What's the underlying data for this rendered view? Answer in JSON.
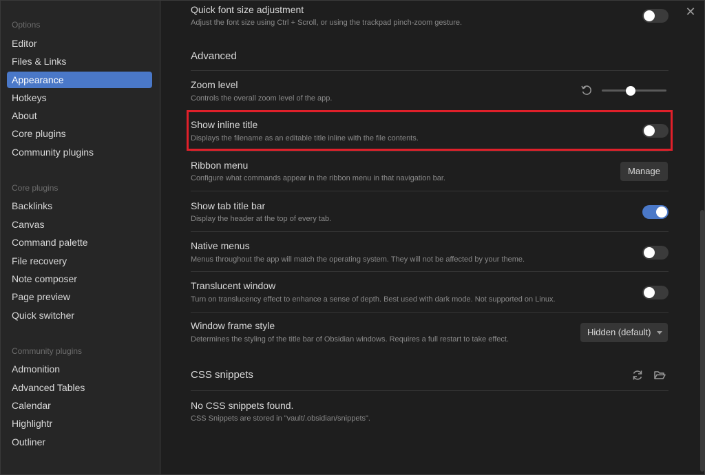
{
  "sidebar": {
    "groups": [
      {
        "title": "Options",
        "items": [
          "Editor",
          "Files & Links",
          "Appearance",
          "Hotkeys",
          "About",
          "Core plugins",
          "Community plugins"
        ]
      },
      {
        "title": "Core plugins",
        "items": [
          "Backlinks",
          "Canvas",
          "Command palette",
          "File recovery",
          "Note composer",
          "Page preview",
          "Quick switcher"
        ]
      },
      {
        "title": "Community plugins",
        "items": [
          "Admonition",
          "Advanced Tables",
          "Calendar",
          "Highlightr",
          "Outliner"
        ]
      }
    ],
    "active_item": "Appearance"
  },
  "main": {
    "close_glyph": "✕",
    "quick_font": {
      "name": "Quick font size adjustment",
      "desc": "Adjust the font size using Ctrl + Scroll, or using the trackpad pinch-zoom gesture.",
      "enabled": false
    },
    "advanced_heading": "Advanced",
    "zoom": {
      "name": "Zoom level",
      "desc": "Controls the overall zoom level of the app.",
      "value_fraction": 0.45
    },
    "inline_title": {
      "name": "Show inline title",
      "desc": "Displays the filename as an editable title inline with the file contents.",
      "enabled": false
    },
    "ribbon": {
      "name": "Ribbon menu",
      "desc": "Configure what commands appear in the ribbon menu in that navigation bar.",
      "button": "Manage"
    },
    "tab_title": {
      "name": "Show tab title bar",
      "desc": "Display the header at the top of every tab.",
      "enabled": true
    },
    "native_menus": {
      "name": "Native menus",
      "desc": "Menus throughout the app will match the operating system. They will not be affected by your theme.",
      "enabled": false
    },
    "translucent": {
      "name": "Translucent window",
      "desc": "Turn on translucency effect to enhance a sense of depth. Best used with dark mode. Not supported on Linux.",
      "enabled": false
    },
    "frame_style": {
      "name": "Window frame style",
      "desc": "Determines the styling of the title bar of Obsidian windows. Requires a full restart to take effect.",
      "selected": "Hidden (default)"
    },
    "css_heading": "CSS snippets",
    "no_snippets": {
      "name": "No CSS snippets found.",
      "desc": "CSS Snippets are stored in \"vault/.obsidian/snippets\"."
    }
  },
  "colors": {
    "accent": "#4a78c8",
    "highlight": "#e0202a",
    "background": "#1e1e1e",
    "sidebar": "#262626"
  }
}
